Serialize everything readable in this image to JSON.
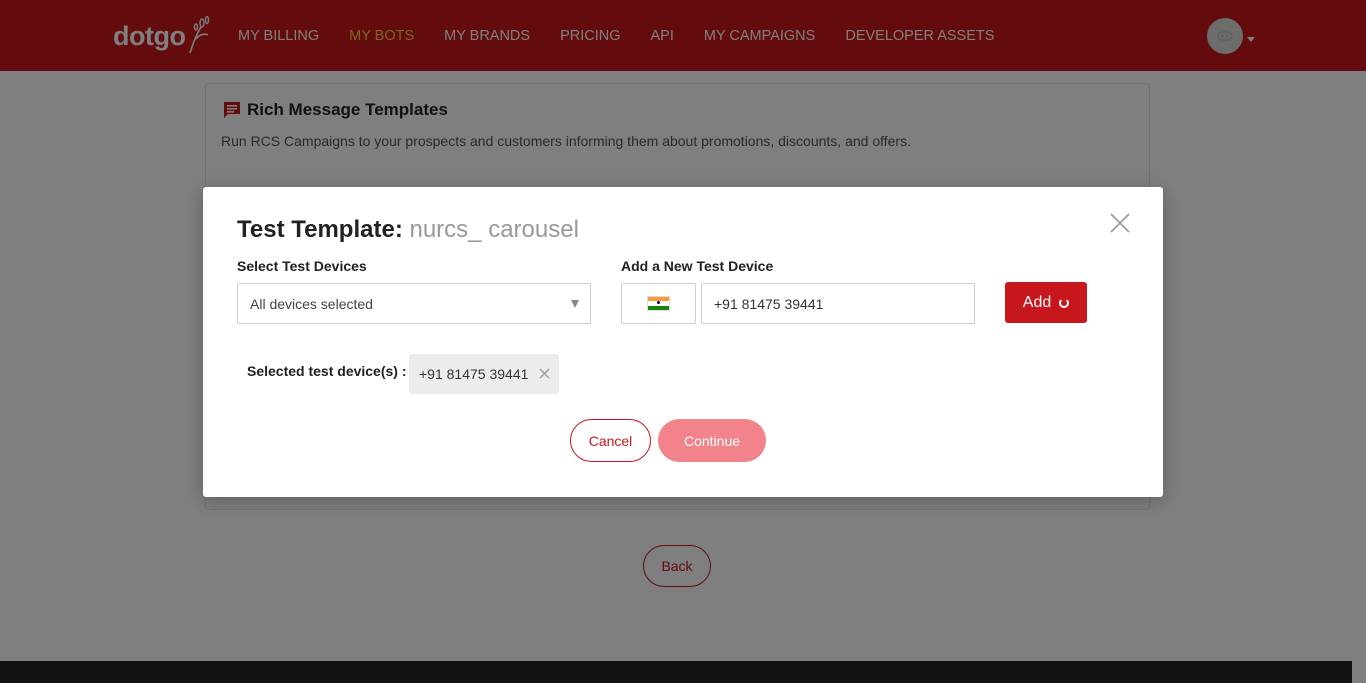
{
  "colors": {
    "brand": "#c8161d",
    "active_nav": "#f2d04a",
    "continue_disabled": "#f3838a"
  },
  "header": {
    "logo_text": "dotgo",
    "nav": [
      {
        "label": "MY BILLING",
        "active": false
      },
      {
        "label": "MY BOTS",
        "active": true
      },
      {
        "label": "MY BRANDS",
        "active": false
      },
      {
        "label": "PRICING",
        "active": false
      },
      {
        "label": "API",
        "active": false
      },
      {
        "label": "MY CAMPAIGNS",
        "active": false
      },
      {
        "label": "DEVELOPER ASSETS",
        "active": false
      }
    ],
    "avatar_icon": "user-avatar-icon"
  },
  "page": {
    "card_title": "Rich Message Templates",
    "card_description": "Run RCS Campaigns to your prospects and customers informing them about promotions, discounts, and offers.",
    "back_label": "Back"
  },
  "modal": {
    "title_label": "Test Template:",
    "template_name": "nurcs_ carousel",
    "select_devices_label": "Select Test Devices",
    "select_devices_value": "All devices selected",
    "new_device_label": "Add a New Test Device",
    "country_flag": "india-flag-icon",
    "phone_value": "+91 81475 39441",
    "add_label": "Add",
    "selected_devices_label": "Selected test device(s) :",
    "selected_devices": [
      "+91 81475 39441"
    ],
    "cancel_label": "Cancel",
    "continue_label": "Continue"
  }
}
